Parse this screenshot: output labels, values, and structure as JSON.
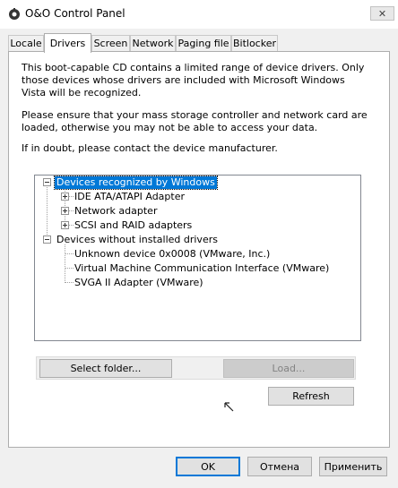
{
  "window": {
    "title": "O&O Control Panel",
    "close_glyph": "✕"
  },
  "tabs": [
    {
      "label": "Locale",
      "active": false
    },
    {
      "label": "Drivers",
      "active": true
    },
    {
      "label": "Screen",
      "active": false
    },
    {
      "label": "Network",
      "active": false
    },
    {
      "label": "Paging file",
      "active": false
    },
    {
      "label": "Bitlocker",
      "active": false
    }
  ],
  "drivers": {
    "intro": "This boot-capable CD contains a limited range of device drivers. Only those devices whose drivers are included with Microsoft Windows Vista will be recognized.",
    "warning": "Please ensure that your mass storage controller and network card are loaded, otherwise you may not be able to access your data.",
    "contact": "If in doubt, please contact the device manufacturer.",
    "tree": {
      "recognized": {
        "label": "Devices recognized by Windows",
        "children": [
          "IDE ATA/ATAPI Adapter",
          "Network adapter",
          "SCSI and RAID adapters"
        ]
      },
      "without_drivers": {
        "label": "Devices without installed drivers",
        "children": [
          "Unknown device 0x0008 (VMware, Inc.)",
          "Virtual Machine Communication Interface (VMware)",
          "SVGA II Adapter (VMware)"
        ]
      }
    },
    "select_folder_label": "Select folder...",
    "load_label": "Load...",
    "refresh_label": "Refresh"
  },
  "footer": {
    "ok_label": "OK",
    "cancel_label": "Отмена",
    "apply_label": "Применить"
  },
  "colors": {
    "accent": "#0078d7",
    "selection": "#0078d7"
  }
}
